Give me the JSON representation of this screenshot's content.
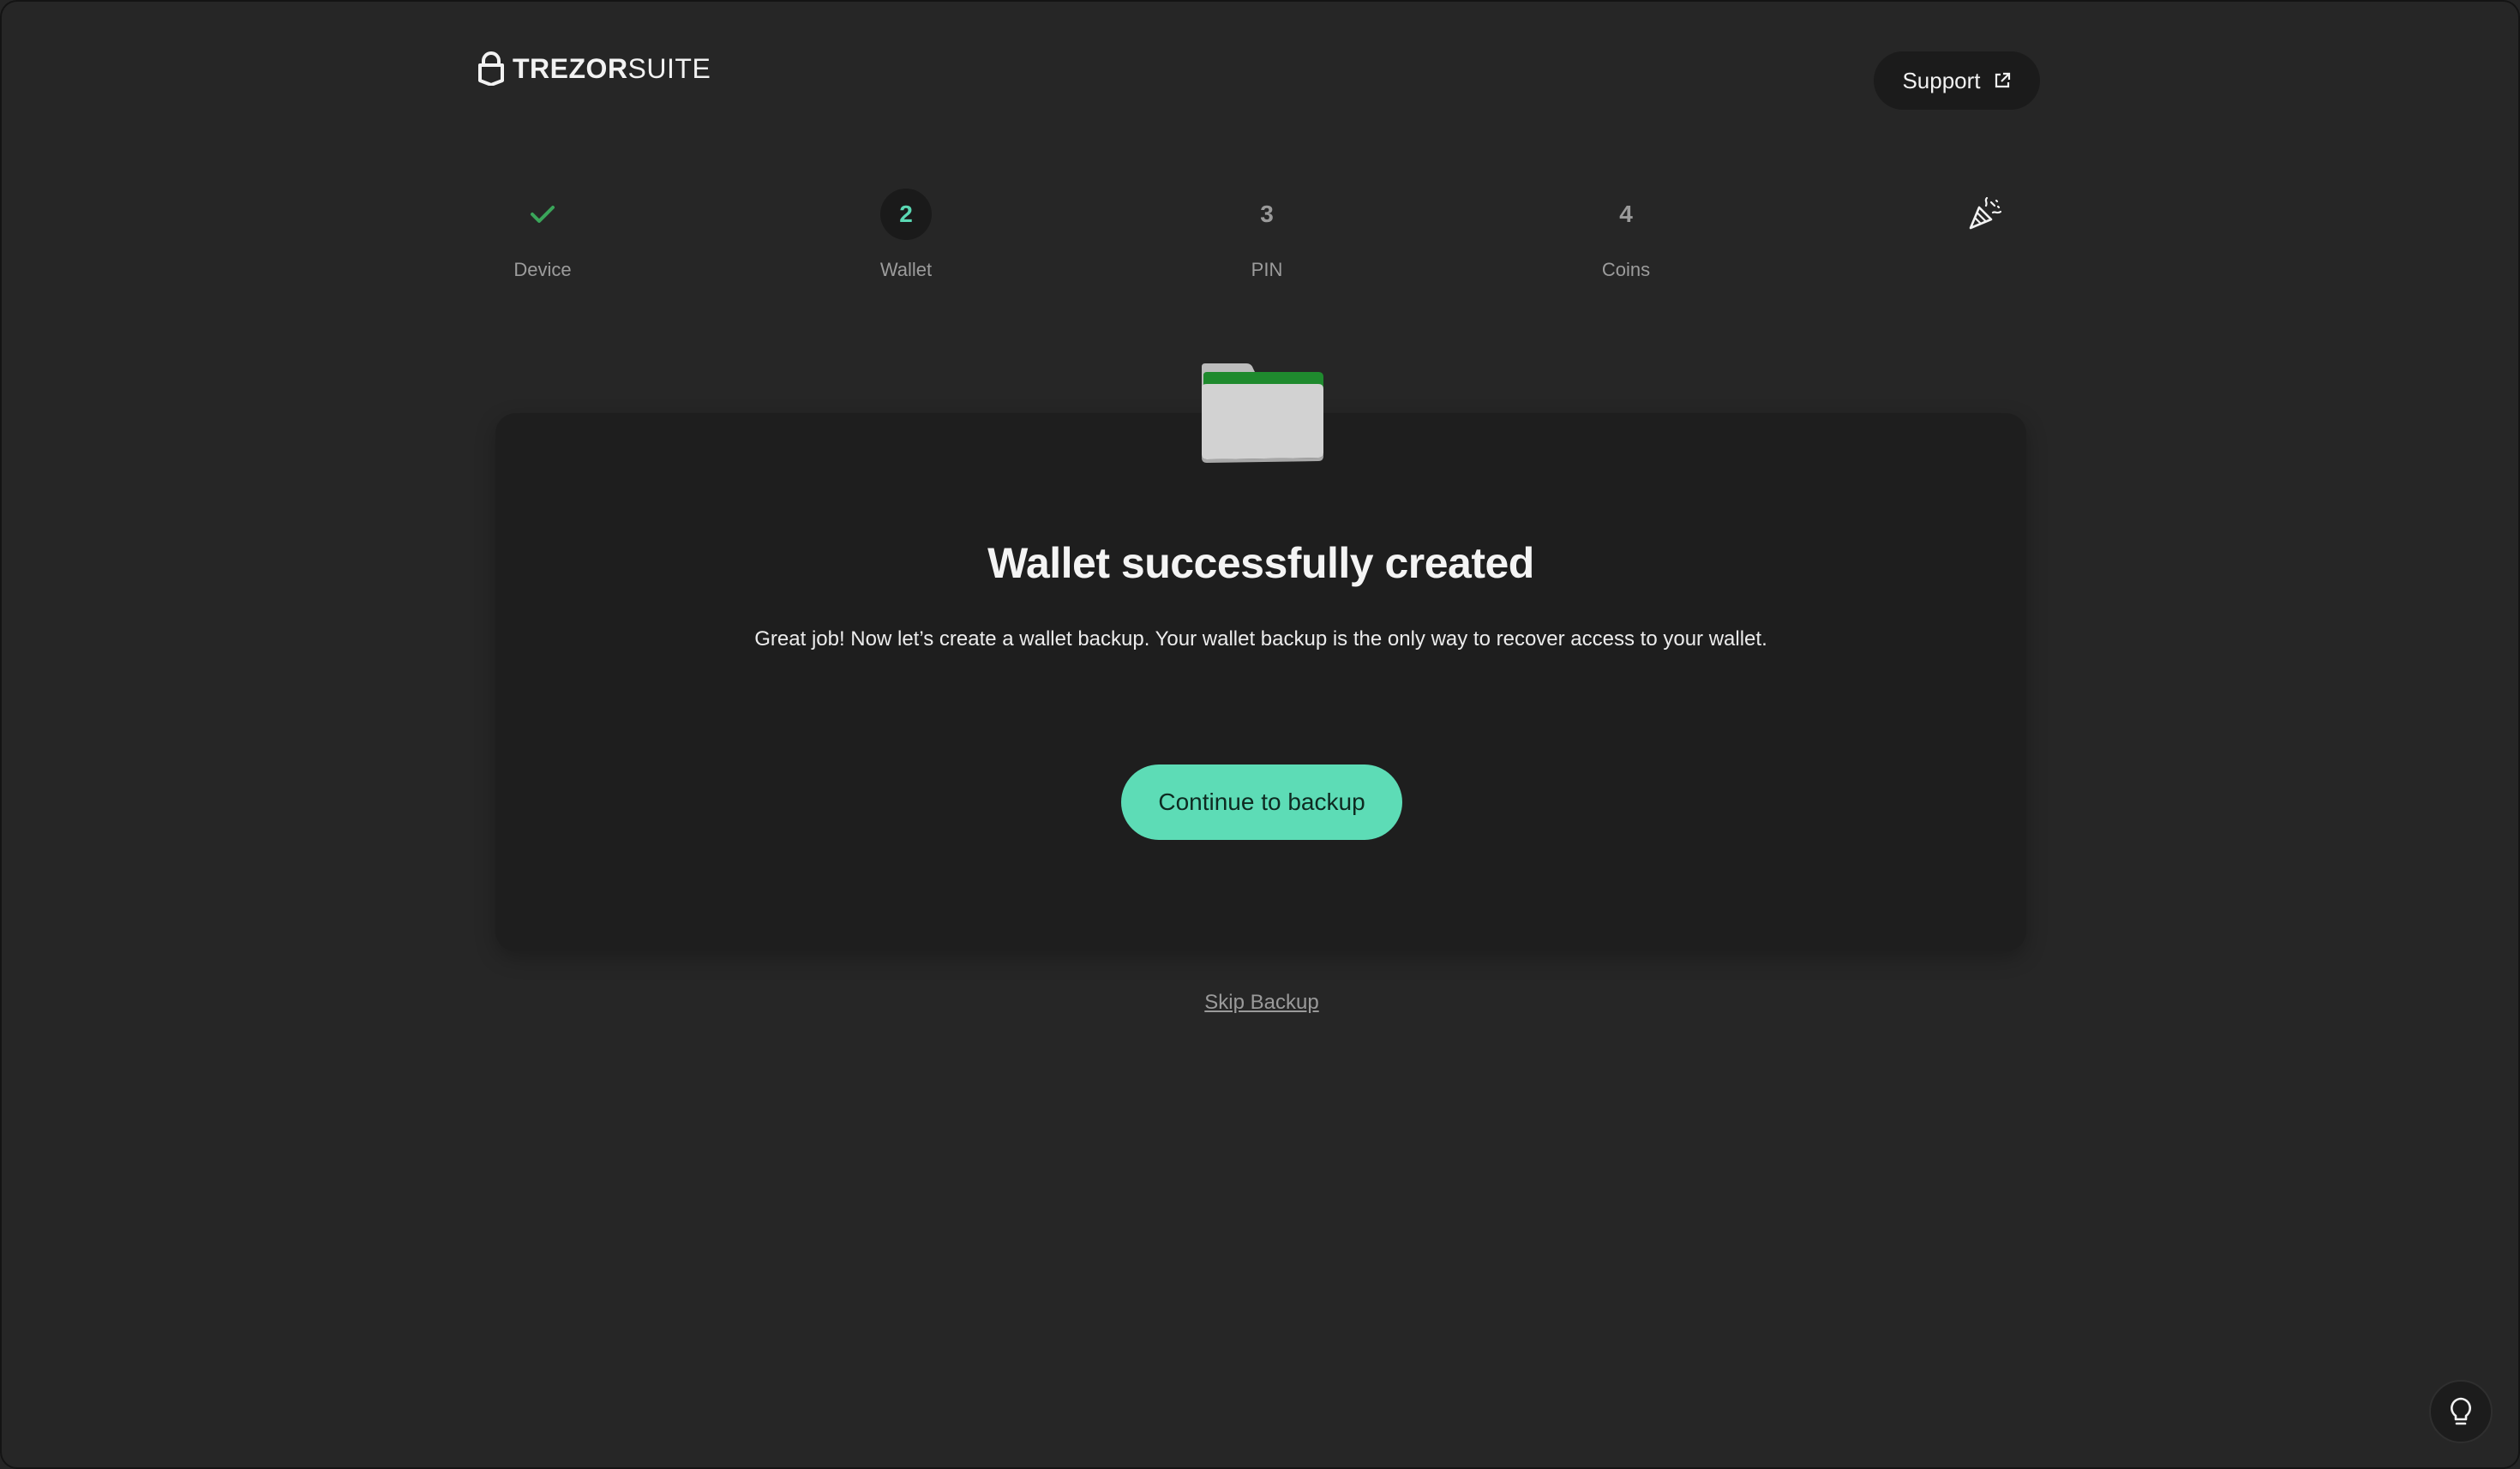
{
  "header": {
    "logo_bold": "TREZOR",
    "logo_light": "SUITE",
    "support_label": "Support"
  },
  "stepper": {
    "steps": [
      {
        "number": "",
        "label": "Device",
        "state": "completed"
      },
      {
        "number": "2",
        "label": "Wallet",
        "state": "active"
      },
      {
        "number": "3",
        "label": "PIN",
        "state": "pending"
      },
      {
        "number": "4",
        "label": "Coins",
        "state": "pending"
      },
      {
        "number": "",
        "label": "",
        "state": "final",
        "icon": "party-popper-icon"
      }
    ]
  },
  "card": {
    "icon": "folder-icon",
    "title": "Wallet successfully created",
    "description": "Great job! Now let’s create a wallet backup. Your wallet backup is the only way to recover access to your wallet.",
    "continue_label": "Continue to backup"
  },
  "skip_label": "Skip Backup",
  "tips_icon": "lightbulb-icon",
  "colors": {
    "accent": "#5ddcb6",
    "check": "#3aa55a",
    "background": "#262626",
    "card": "#1e1e1e"
  }
}
